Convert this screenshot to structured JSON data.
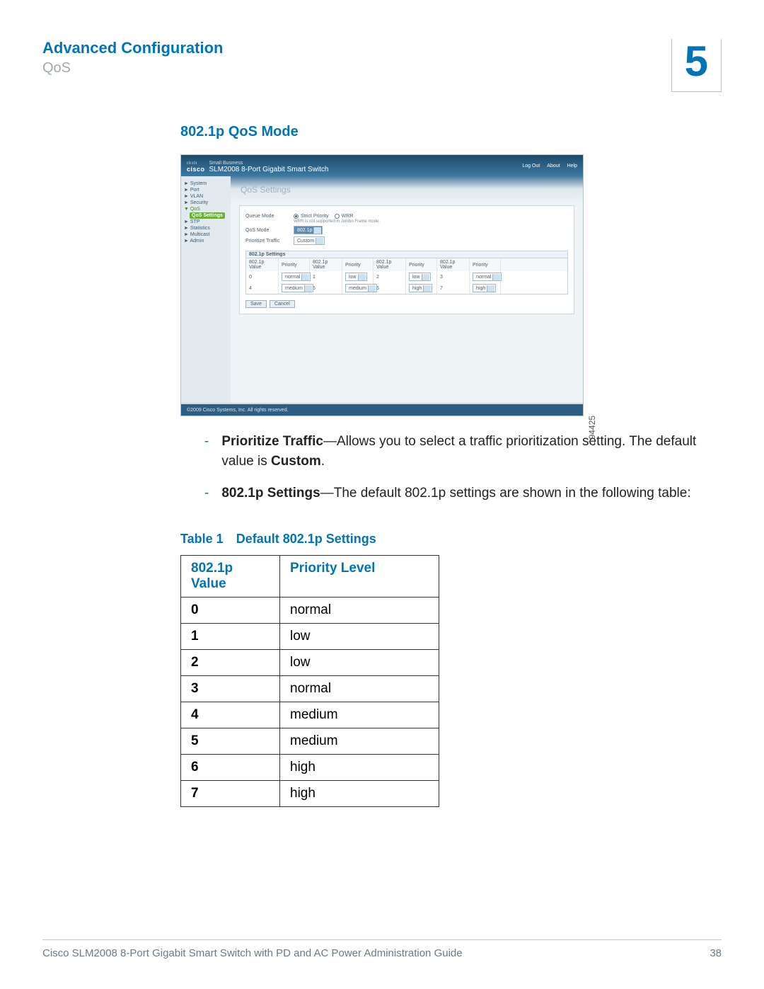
{
  "header": {
    "title": "Advanced Configuration",
    "subtitle": "QoS",
    "chapter_number": "5"
  },
  "section": {
    "heading": "802.1p QoS Mode"
  },
  "screenshot": {
    "figure_id": "194425",
    "brand_small": "Small Business",
    "brand_cisco": "cisco",
    "product_name": "SLM2008 8-Port Gigabit Smart Switch",
    "top_links": {
      "logout": "Log Out",
      "about": "About",
      "help": "Help"
    },
    "nav": {
      "items": [
        "System",
        "Port",
        "VLAN",
        "Security"
      ],
      "qos_group": "QoS",
      "qos_sub_active": "QoS Settings",
      "items2": [
        "STP",
        "Statistics",
        "Multicast",
        "Admin"
      ]
    },
    "panel_title": "QoS Settings",
    "queue_mode": {
      "label": "Queue Mode",
      "opt_strict": "Strict Priority",
      "opt_wrr": "WRR",
      "note": "WRR is not supported in Jumbo Frame mode."
    },
    "qos_mode": {
      "label": "QoS Mode",
      "value": "802.1p"
    },
    "prioritize": {
      "label": "Prioritize Traffic",
      "value": "Custom"
    },
    "settings_header": "802.1p Settings",
    "col_value": "802.1p Value",
    "col_priority": "Priority",
    "rows": [
      {
        "v": "0",
        "p": "normal"
      },
      {
        "v": "1",
        "p": "low"
      },
      {
        "v": "2",
        "p": "low"
      },
      {
        "v": "3",
        "p": "normal"
      },
      {
        "v": "4",
        "p": "medium"
      },
      {
        "v": "5",
        "p": "medium"
      },
      {
        "v": "6",
        "p": "high"
      },
      {
        "v": "7",
        "p": "high"
      }
    ],
    "btn_save": "Save",
    "btn_cancel": "Cancel",
    "copyright": "©2009 Cisco Systems, Inc. All rights reserved."
  },
  "bullets": {
    "b1_strong": "Prioritize Traffic",
    "b1_rest": "—Allows you to select a traffic prioritization setting. The default value is ",
    "b1_tail_strong": "Custom",
    "b1_period": ".",
    "b2_strong": "802.1p Settings",
    "b2_rest": "—The default 802.1p settings are shown in the following table:"
  },
  "table": {
    "caption_label": "Table 1",
    "caption_text": "Default 802.1p Settings",
    "col1": "802.1p Value",
    "col2": "Priority Level",
    "rows": [
      {
        "v": "0",
        "p": "normal"
      },
      {
        "v": "1",
        "p": "low"
      },
      {
        "v": "2",
        "p": "low"
      },
      {
        "v": "3",
        "p": "normal"
      },
      {
        "v": "4",
        "p": "medium"
      },
      {
        "v": "5",
        "p": "medium"
      },
      {
        "v": "6",
        "p": "high"
      },
      {
        "v": "7",
        "p": "high"
      }
    ]
  },
  "footer": {
    "doc": "Cisco SLM2008 8-Port Gigabit Smart Switch with PD and AC Power Administration Guide",
    "page": "38"
  }
}
